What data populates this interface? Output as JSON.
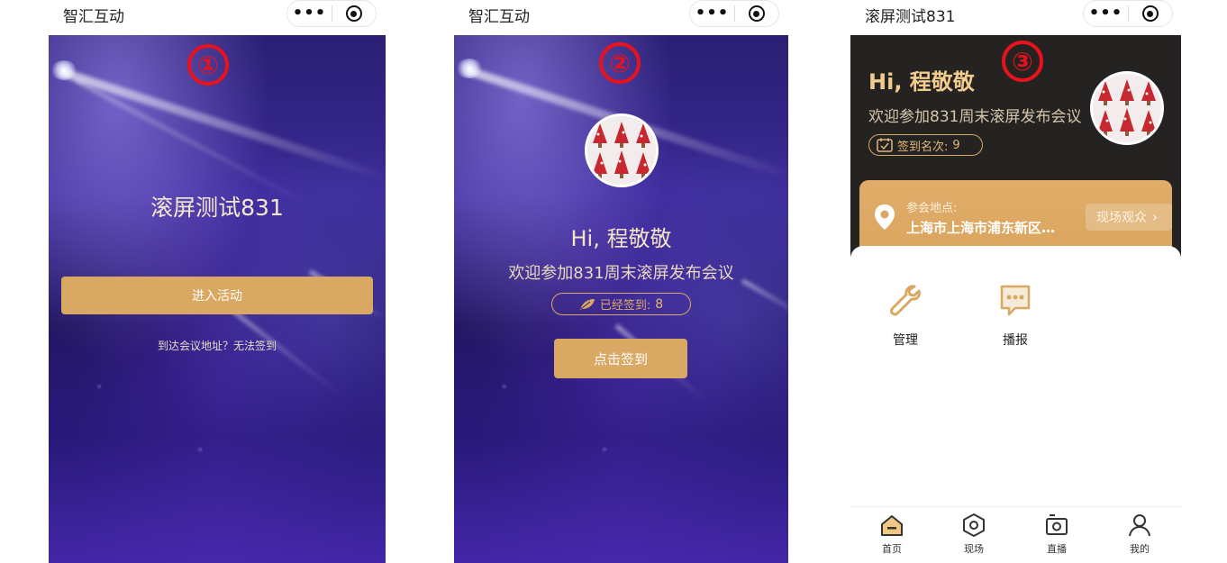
{
  "panels": [
    {
      "app_title": "智汇互动",
      "more_icon": "more-dots-icon",
      "close_icon": "target-close-icon",
      "step_marker": "①",
      "event_title": "滚屏测试831",
      "enter_button": "进入活动",
      "location_link": "到达会议地址？无法签到"
    },
    {
      "app_title": "智汇互动",
      "step_marker": "②",
      "greeting": "Hi, 程敬敬",
      "welcome": "欢迎参加831周末滚屏发布会议",
      "signed_label": "已经签到:",
      "signed_count": "8",
      "signin_button": "点击签到"
    },
    {
      "app_title": "滚屏测试831",
      "step_marker": "③",
      "greeting": "Hi, 程敬敬",
      "welcome": "欢迎参加831周末滚屏发布会议",
      "rank_label": "签到名次:",
      "rank_value": "9",
      "location": {
        "label": "参会地点:",
        "address": "上海市上海市浦东新区…",
        "button": "现场观众"
      },
      "grid": [
        {
          "label": "管理",
          "icon": "wrench-icon"
        },
        {
          "label": "播报",
          "icon": "chat-bubble-icon"
        }
      ],
      "tabs": [
        {
          "label": "首页",
          "icon": "home-icon"
        },
        {
          "label": "现场",
          "icon": "hexagon-icon"
        },
        {
          "label": "直播",
          "icon": "camera-icon"
        },
        {
          "label": "我的",
          "icon": "user-icon"
        }
      ]
    }
  ],
  "colors": {
    "gold": "#d9a862",
    "marker_red": "#e8121c",
    "header_dark": "#252322"
  }
}
